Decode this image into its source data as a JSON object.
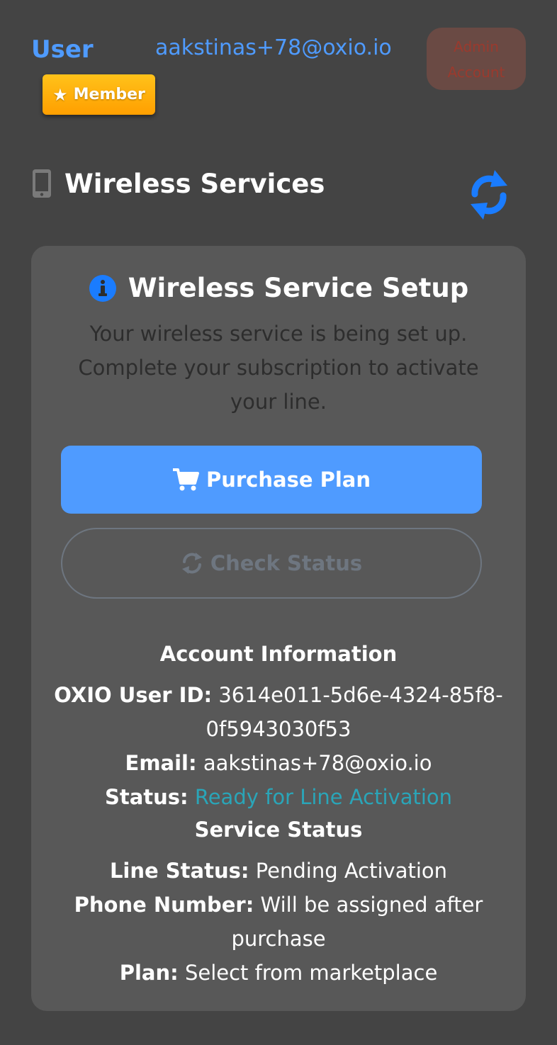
{
  "header": {
    "title": "User",
    "email": "aakstinas+78@oxio.io",
    "admin_button_line1": "Admin",
    "admin_button_line2": "Account",
    "badge": "Member"
  },
  "section": {
    "title": "Wireless Services"
  },
  "card": {
    "title": "Wireless Service Setup",
    "description": "Your wireless service is being set up. Complete your subscription to activate your line.",
    "purchase_label": "Purchase Plan",
    "check_label": "Check Status"
  },
  "account": {
    "heading": "Account Information",
    "user_id_label": "OXIO User ID:",
    "user_id": "3614e011-5d6e-4324-85f8-0f5943030f53",
    "email_label": "Email:",
    "email": "aakstinas+78@oxio.io",
    "status_label": "Status:",
    "status": "Ready for Line Activation"
  },
  "service": {
    "heading": "Service Status",
    "line_status_label": "Line Status:",
    "line_status": "Pending Activation",
    "phone_label": "Phone Number:",
    "phone": "Will be assigned after purchase",
    "plan_label": "Plan:",
    "plan": "Select from marketplace"
  },
  "colors": {
    "background": "#444444",
    "card": "#585858",
    "accent": "#4f9bff",
    "badge": "#ffb300",
    "status": "#2aa5b8"
  },
  "icons": {
    "section": "mobile-phone-icon",
    "refresh": "refresh-icon",
    "info": "info-circle-icon",
    "cart": "shopping-cart-icon",
    "check": "sync-icon",
    "badge": "star-icon"
  }
}
